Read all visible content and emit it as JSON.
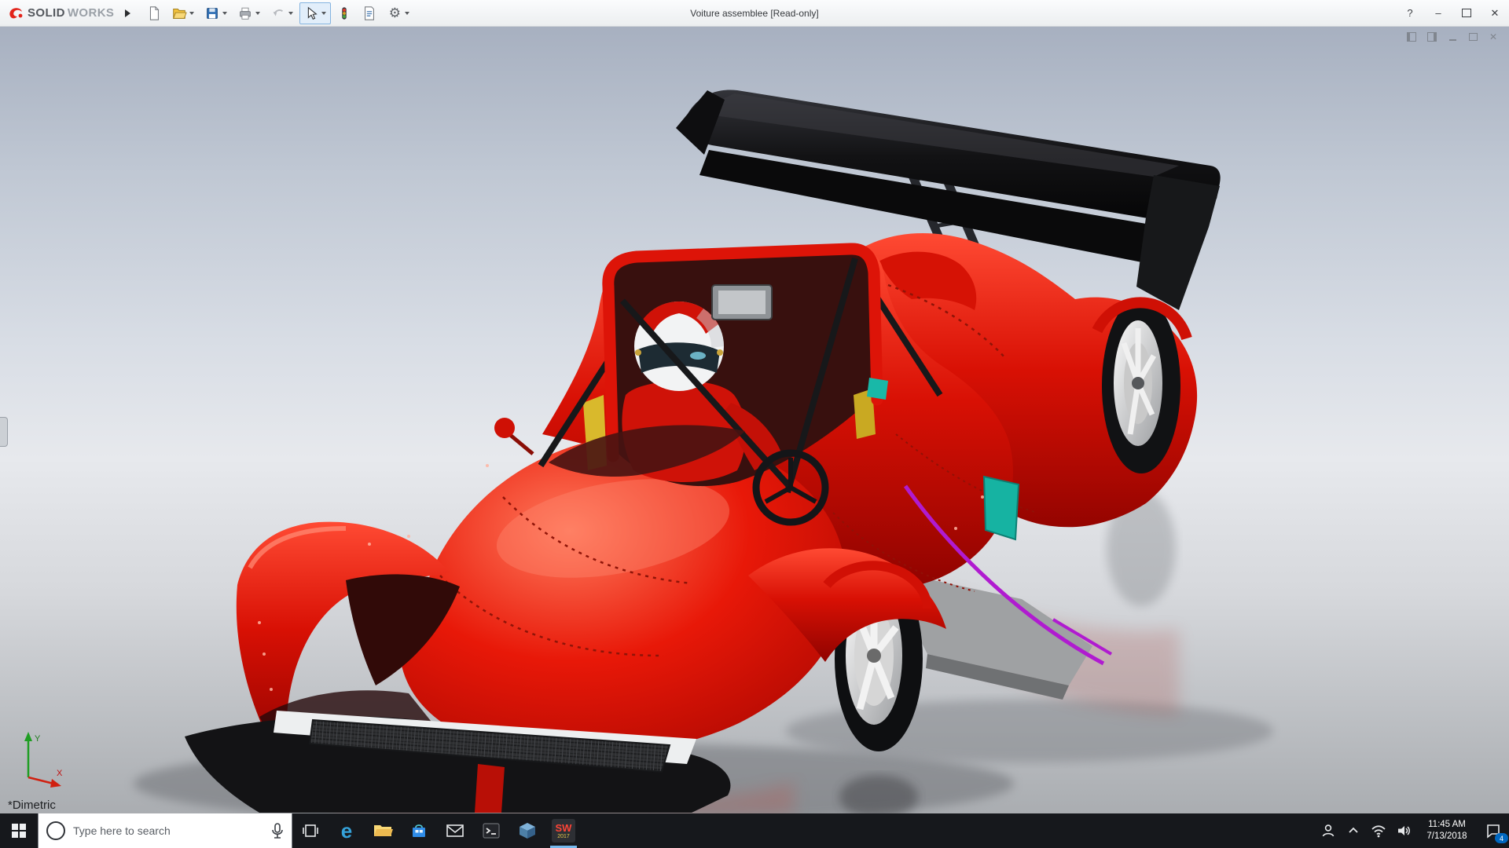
{
  "titlebar": {
    "brand": {
      "solid": "SOLID",
      "works": "WORKS"
    },
    "title": "Voiture assemblee [Read-only]"
  },
  "icons": {
    "help": "?",
    "minimize": "–",
    "close": "✕",
    "gear": "⚙"
  },
  "toolbar": {
    "active_tool": "select"
  },
  "viewport": {
    "view_label": "*Dimetric",
    "triad": {
      "x_label": "X",
      "y_label": "Y"
    }
  },
  "model": {
    "colors": {
      "body_red": "#d61205",
      "wing_black": "#141414",
      "accent_purple": "#b01bd0",
      "accent_teal": "#16b3a2",
      "rim_silver": "#d9d9d9"
    }
  },
  "taskbar": {
    "search_placeholder": "Type here to search",
    "edge_glyph": "e",
    "sw_line1": "SW",
    "sw_line2": "2017",
    "time": "11:45 AM",
    "date": "7/13/2018",
    "notification_count": "4"
  }
}
